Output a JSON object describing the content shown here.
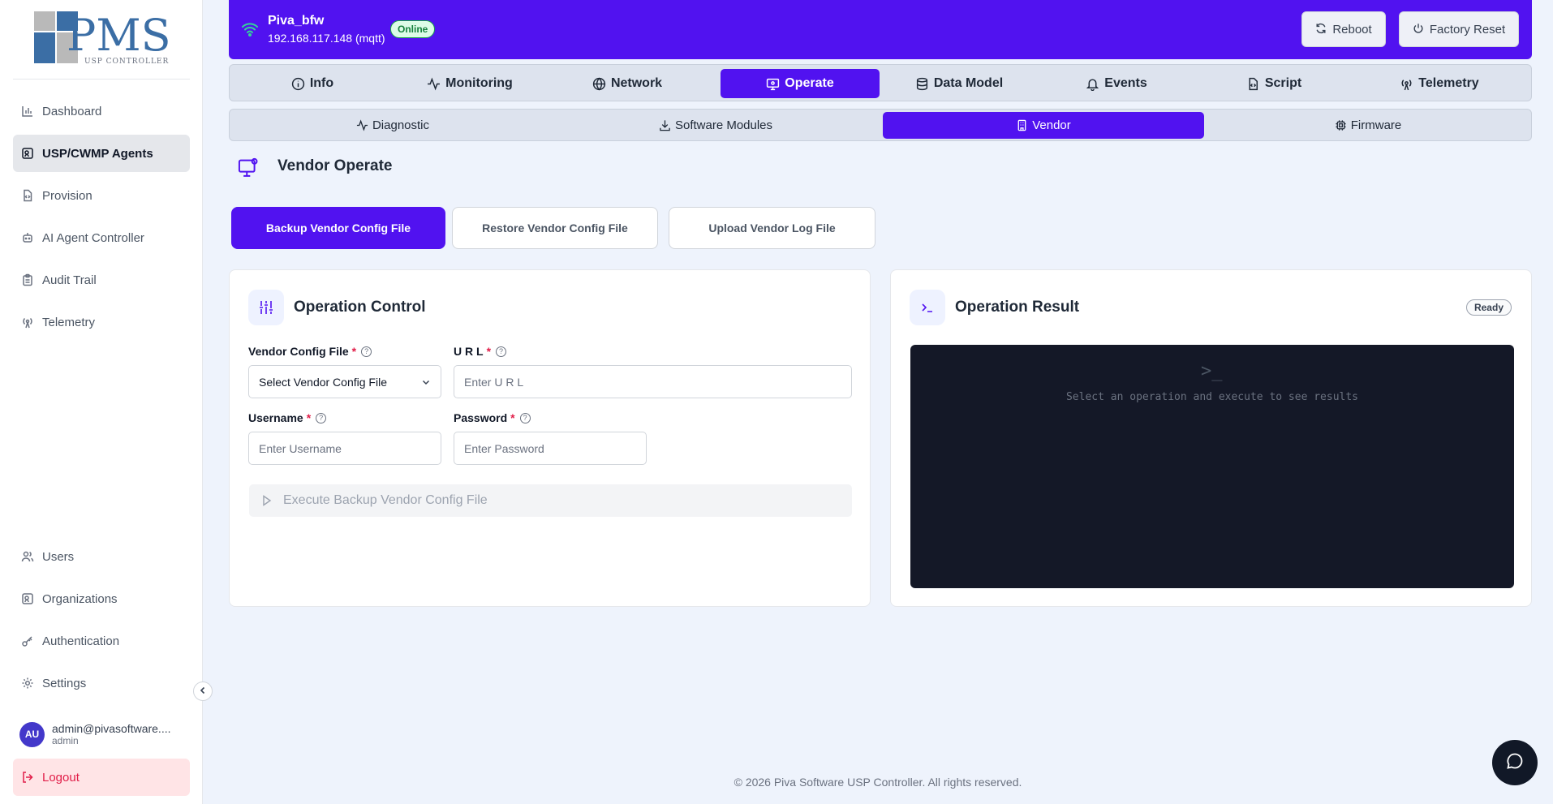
{
  "brand": {
    "logo_text": "PMS",
    "logo_subtext": "USP CONTROLLER"
  },
  "sidebar": {
    "items": [
      {
        "label": "Dashboard",
        "icon": "bar-chart-icon"
      },
      {
        "label": "USP/CWMP Agents",
        "icon": "agents-icon",
        "active": true
      },
      {
        "label": "Provision",
        "icon": "file-code-icon"
      },
      {
        "label": "AI Agent Controller",
        "icon": "bot-icon"
      },
      {
        "label": "Audit Trail",
        "icon": "clipboard-icon"
      },
      {
        "label": "Telemetry",
        "icon": "antenna-icon"
      }
    ],
    "bottom_items": [
      {
        "label": "Users",
        "icon": "users-icon"
      },
      {
        "label": "Organizations",
        "icon": "organization-icon"
      },
      {
        "label": "Authentication",
        "icon": "key-icon"
      },
      {
        "label": "Settings",
        "icon": "gear-icon"
      }
    ],
    "user": {
      "initials": "AU",
      "email": "admin@pivasoftware....",
      "role": "admin"
    },
    "logout_label": "Logout"
  },
  "device": {
    "name": "Piva_bfw",
    "address": "192.168.117.148 (mqtt)",
    "status": "Online",
    "reboot_label": "Reboot",
    "factory_reset_label": "Factory Reset"
  },
  "main_tabs": [
    {
      "label": "Info",
      "icon": "info-icon"
    },
    {
      "label": "Monitoring",
      "icon": "activity-icon"
    },
    {
      "label": "Network",
      "icon": "globe-icon"
    },
    {
      "label": "Operate",
      "icon": "monitor-cog-icon",
      "active": true
    },
    {
      "label": "Data Model",
      "icon": "database-icon"
    },
    {
      "label": "Events",
      "icon": "bell-icon"
    },
    {
      "label": "Script",
      "icon": "file-code-icon"
    },
    {
      "label": "Telemetry",
      "icon": "antenna-icon"
    }
  ],
  "sub_tabs": [
    {
      "label": "Diagnostic",
      "icon": "activity-icon"
    },
    {
      "label": "Software Modules",
      "icon": "download-icon"
    },
    {
      "label": "Vendor",
      "icon": "building-icon",
      "active": true
    },
    {
      "label": "Firmware",
      "icon": "chip-icon"
    }
  ],
  "section": {
    "title": "Vendor Operate"
  },
  "operations": [
    {
      "label": "Backup Vendor Config File",
      "active": true
    },
    {
      "label": "Restore Vendor Config File"
    },
    {
      "label": "Upload Vendor Log File"
    }
  ],
  "control": {
    "title": "Operation Control",
    "vendor_config_label": "Vendor Config File",
    "vendor_config_value": "Select Vendor Config File",
    "url_label": "U R L",
    "url_placeholder": "Enter U R L",
    "username_label": "Username",
    "username_placeholder": "Enter Username",
    "password_label": "Password",
    "password_placeholder": "Enter Password",
    "required_mark": "*",
    "execute_label": "Execute Backup Vendor Config File"
  },
  "result": {
    "title": "Operation Result",
    "status": "Ready",
    "terminal_glyph": ">_",
    "empty_text": "Select an operation and execute to see results"
  },
  "footer": {
    "text": "© 2026 Piva Software USP Controller. All rights reserved."
  },
  "colors": {
    "accent": "#5112f0",
    "danger": "#e11d48",
    "success": "#16a34a",
    "terminal_bg": "#141827"
  }
}
